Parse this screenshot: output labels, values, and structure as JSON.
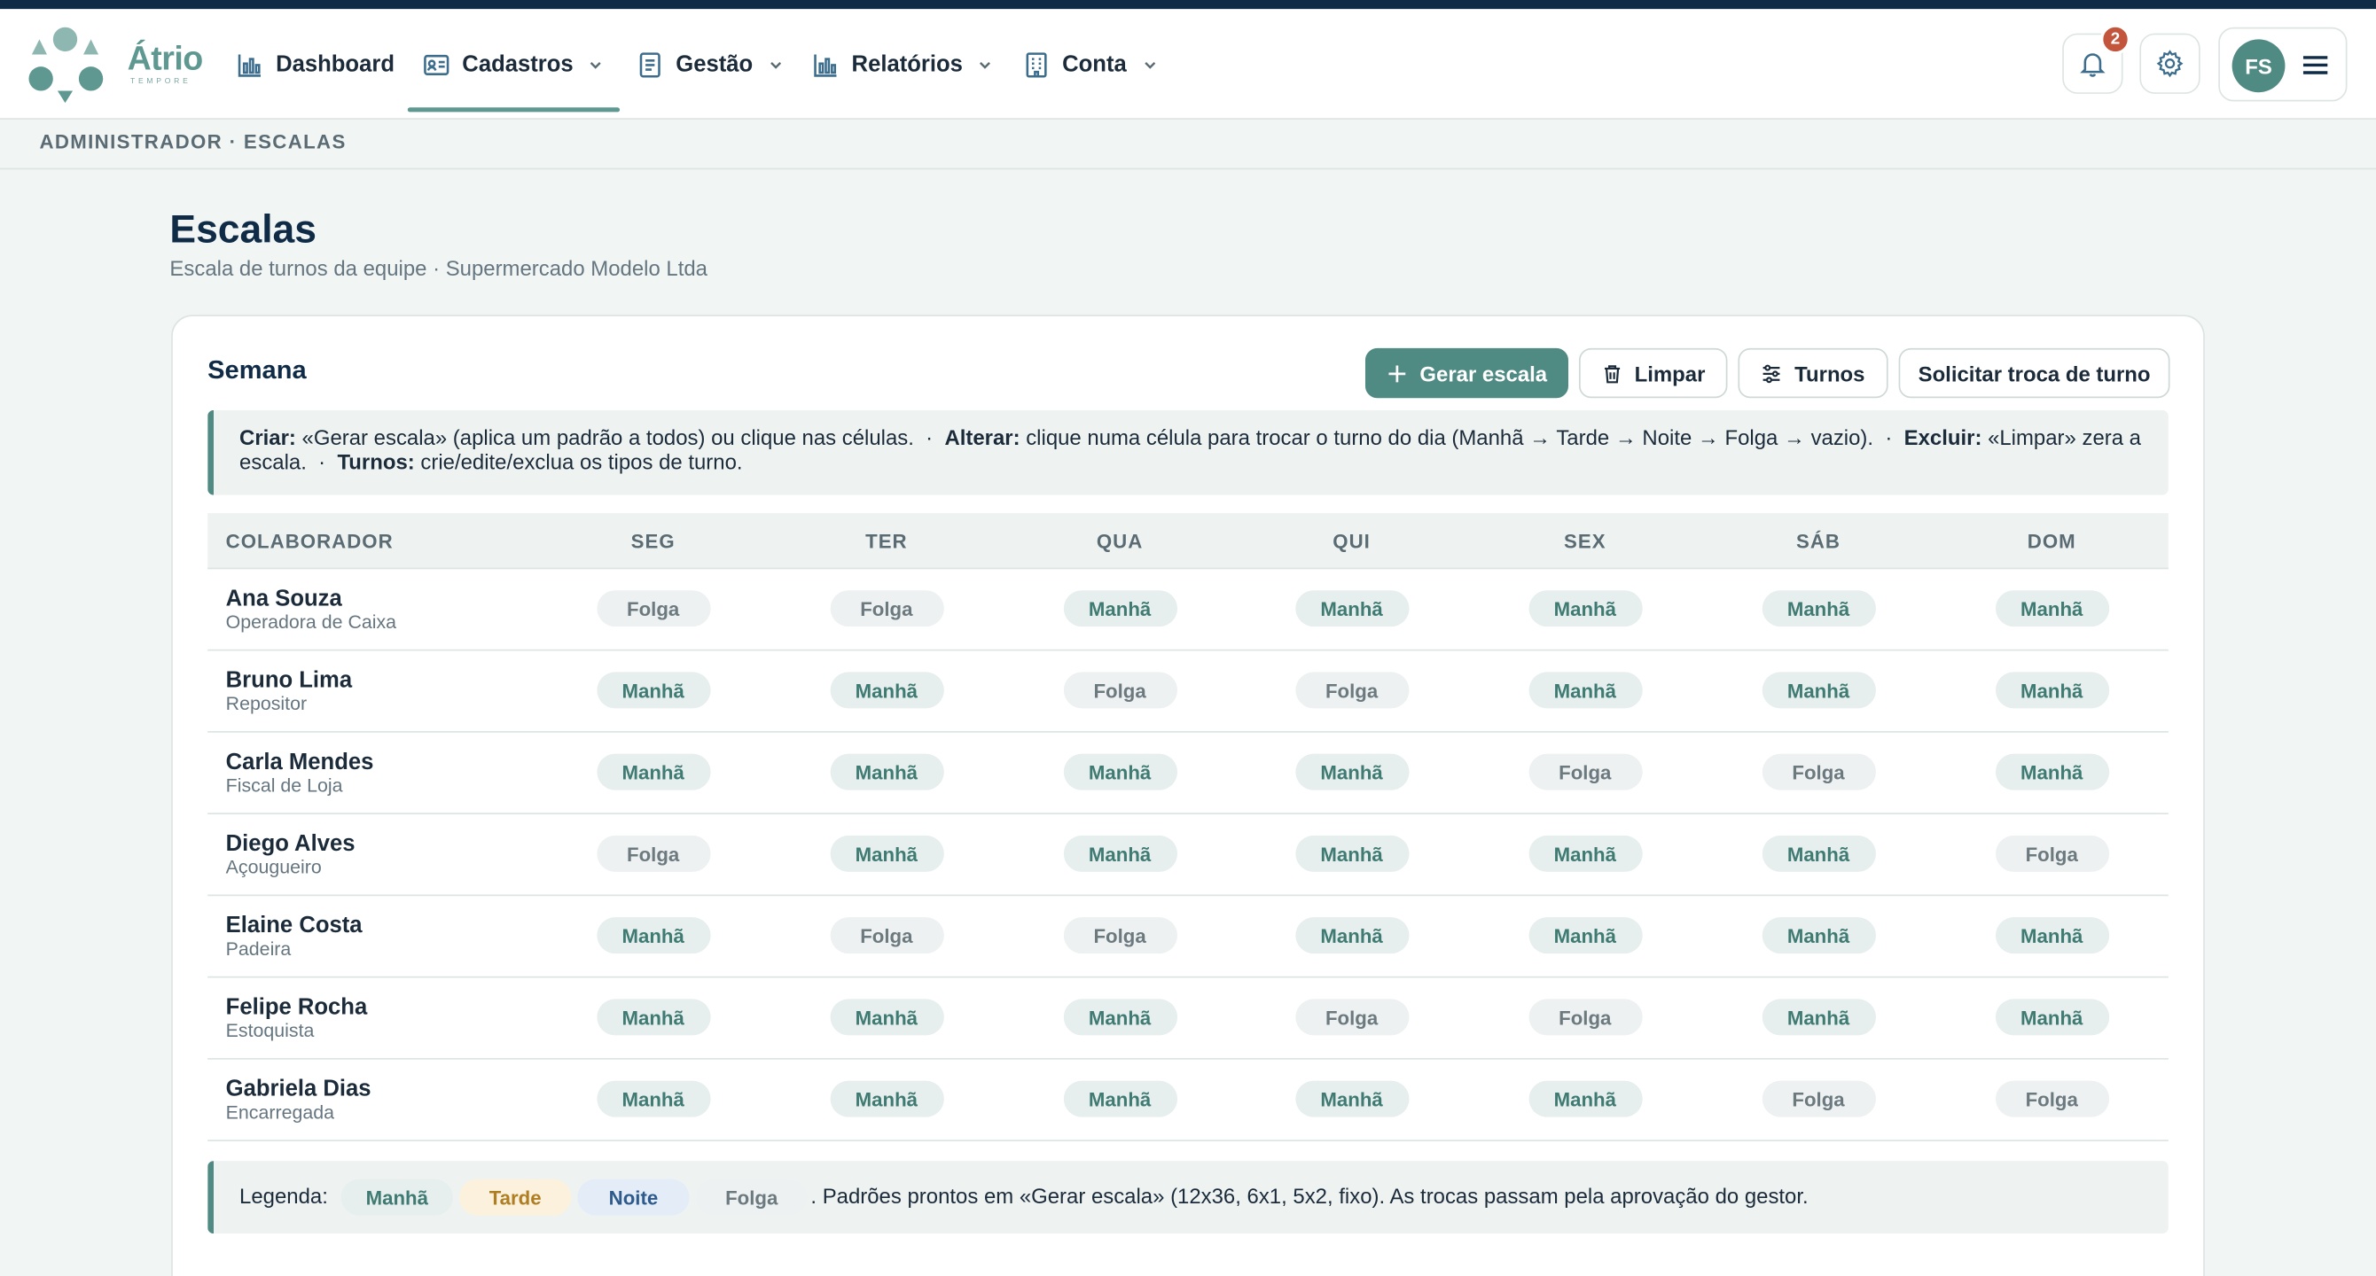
{
  "app": {
    "brand_name": "Átrio",
    "brand_sub": "TEMPORE"
  },
  "nav": {
    "items": [
      {
        "label": "Dashboard",
        "icon": "chart-bar-icon",
        "active": false
      },
      {
        "label": "Cadastros",
        "icon": "id-card-icon",
        "active": true
      },
      {
        "label": "Gestão",
        "icon": "document-icon",
        "active": false
      },
      {
        "label": "Relatórios",
        "icon": "chart-bar-icon",
        "active": false
      },
      {
        "label": "Conta",
        "icon": "building-icon",
        "active": false
      }
    ],
    "notifications_count": "2",
    "user_initials": "FS"
  },
  "breadcrumb": "ADMINISTRADOR · ESCALAS",
  "page": {
    "title": "Escalas",
    "subtitle": "Escala de turnos da equipe · Supermercado Modelo Ltda"
  },
  "card": {
    "title": "Semana",
    "buttons": {
      "generate": "Gerar escala",
      "clear": "Limpar",
      "shifts": "Turnos",
      "swap": "Solicitar troca de turno"
    },
    "info": {
      "create_label": "Criar:",
      "create_text": " «Gerar escala» (aplica um padrão a todos) ou clique nas células.  ·  ",
      "alter_label": "Alterar:",
      "alter_text": " clique numa célula para trocar o turno do dia (Manhã → Tarde → Noite → Folga → vazio).  ·  ",
      "delete_label": "Excluir:",
      "delete_text": " «Limpar» zera a escala.  ·  ",
      "shifts_label": "Turnos:",
      "shifts_text": " crie/edite/exclua os tipos de turno."
    }
  },
  "schedule": {
    "headers": [
      "COLABORADOR",
      "SEG",
      "TER",
      "QUA",
      "QUI",
      "SEX",
      "SÁB",
      "DOM"
    ],
    "rows": [
      {
        "name": "Ana Souza",
        "role": "Operadora de Caixa",
        "days": [
          "Folga",
          "Folga",
          "Manhã",
          "Manhã",
          "Manhã",
          "Manhã",
          "Manhã"
        ]
      },
      {
        "name": "Bruno Lima",
        "role": "Repositor",
        "days": [
          "Manhã",
          "Manhã",
          "Folga",
          "Folga",
          "Manhã",
          "Manhã",
          "Manhã"
        ]
      },
      {
        "name": "Carla Mendes",
        "role": "Fiscal de Loja",
        "days": [
          "Manhã",
          "Manhã",
          "Manhã",
          "Manhã",
          "Folga",
          "Folga",
          "Manhã"
        ]
      },
      {
        "name": "Diego Alves",
        "role": "Açougueiro",
        "days": [
          "Folga",
          "Manhã",
          "Manhã",
          "Manhã",
          "Manhã",
          "Manhã",
          "Folga"
        ]
      },
      {
        "name": "Elaine Costa",
        "role": "Padeira",
        "days": [
          "Manhã",
          "Folga",
          "Folga",
          "Manhã",
          "Manhã",
          "Manhã",
          "Manhã"
        ]
      },
      {
        "name": "Felipe Rocha",
        "role": "Estoquista",
        "days": [
          "Manhã",
          "Manhã",
          "Manhã",
          "Folga",
          "Folga",
          "Manhã",
          "Manhã"
        ]
      },
      {
        "name": "Gabriela Dias",
        "role": "Encarregada",
        "days": [
          "Manhã",
          "Manhã",
          "Manhã",
          "Manhã",
          "Manhã",
          "Folga",
          "Folga"
        ]
      }
    ]
  },
  "legend": {
    "label": "Legenda:",
    "chips": [
      "Manhã",
      "Tarde",
      "Noite",
      "Folga"
    ],
    "text": ". Padrões prontos em «Gerar escala» (12x36, 6x1, 5x2, fixo). As trocas passam pela aprovação do gestor."
  },
  "colors": {
    "accent": "#4f8a83",
    "navy": "#0f2b46",
    "badge": "#c4553d"
  }
}
